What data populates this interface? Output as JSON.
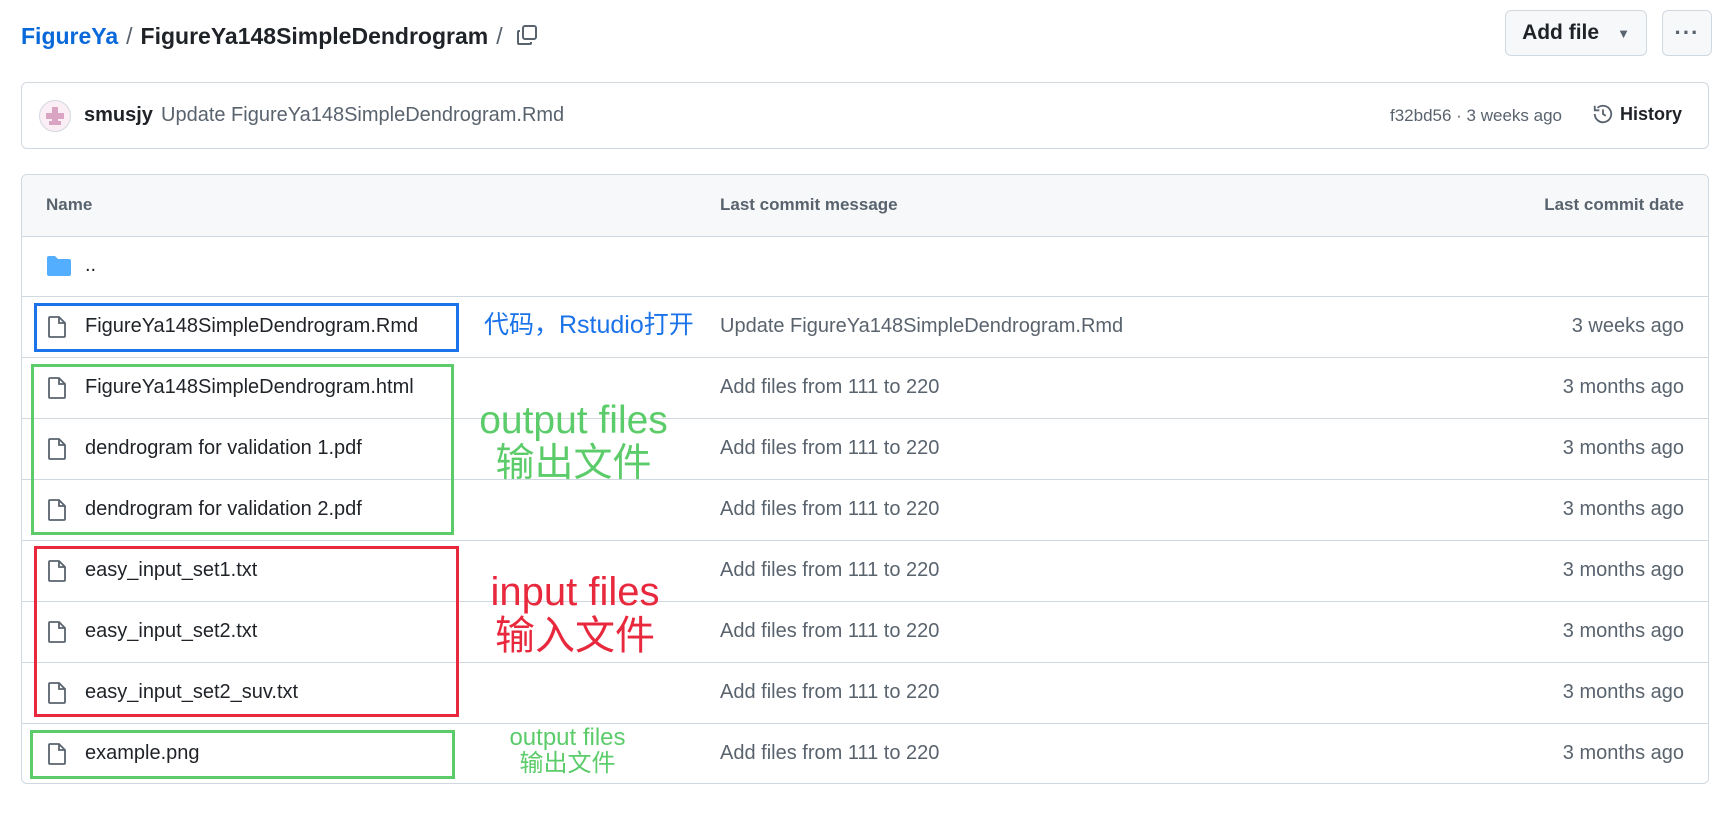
{
  "breadcrumb": {
    "repo": "FigureYa",
    "sep1": "/",
    "folder": "FigureYa148SimpleDendrogram",
    "sep2": "/"
  },
  "toolbar": {
    "add_file_label": "Add file",
    "more_label": "···"
  },
  "commit": {
    "author": "smusjy",
    "message": "Update FigureYa148SimpleDendrogram.Rmd",
    "meta": "f32bd56 · 3 weeks ago",
    "history_label": "History"
  },
  "table": {
    "headers": {
      "name": "Name",
      "message": "Last commit message",
      "date": "Last commit date"
    },
    "parent_label": "..",
    "rows": [
      {
        "name": "FigureYa148SimpleDendrogram.Rmd",
        "message": "Update FigureYa148SimpleDendrogram.Rmd",
        "date": "3 weeks ago"
      },
      {
        "name": "FigureYa148SimpleDendrogram.html",
        "message": "Add files from 111 to 220",
        "date": "3 months ago"
      },
      {
        "name": "dendrogram for validation 1.pdf",
        "message": "Add files from 111 to 220",
        "date": "3 months ago"
      },
      {
        "name": "dendrogram for validation 2.pdf",
        "message": "Add files from 111 to 220",
        "date": "3 months ago"
      },
      {
        "name": "easy_input_set1.txt",
        "message": "Add files from 111 to 220",
        "date": "3 months ago"
      },
      {
        "name": "easy_input_set2.txt",
        "message": "Add files from 111 to 220",
        "date": "3 months ago"
      },
      {
        "name": "easy_input_set2_suv.txt",
        "message": "Add files from 111 to 220",
        "date": "3 months ago"
      },
      {
        "name": "example.png",
        "message": "Add files from 111 to 220",
        "date": "3 months ago"
      }
    ]
  },
  "annotations": {
    "code": "代码，Rstudio打开",
    "output_en": "output files",
    "output_zh": "输出文件",
    "input_en": "input files",
    "input_zh": "输入文件",
    "output2_en": "output files",
    "output2_zh": "输出文件"
  },
  "colors": {
    "link": "#0969da",
    "annotation_blue": "#1a73e8",
    "annotation_green": "#5ccc6b",
    "annotation_red": "#e8283c",
    "folder": "#54aeff"
  },
  "icons": {
    "copy": "copy-icon",
    "folder": "folder-icon",
    "file": "file-icon",
    "history": "history-icon",
    "caret": "triangle-down-icon"
  }
}
